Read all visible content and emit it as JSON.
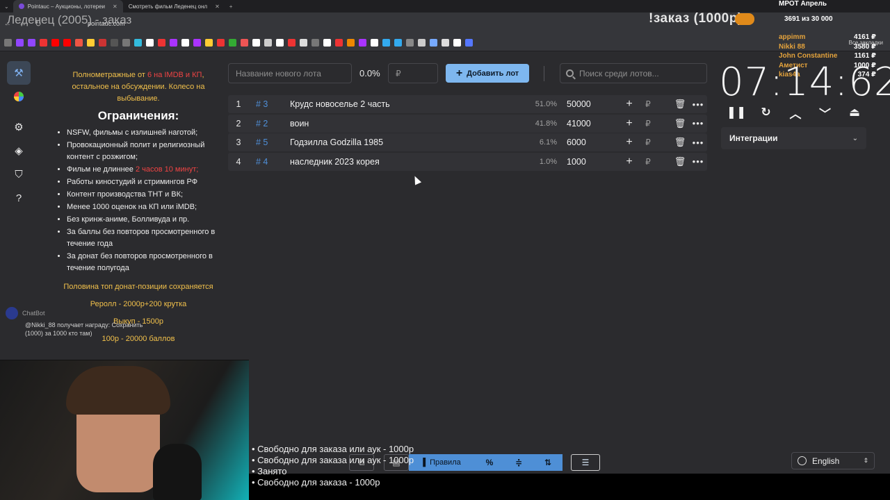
{
  "browser": {
    "tabs": [
      {
        "title": "Pointauc – Аукционы, лотереи",
        "active": true
      },
      {
        "title": "Смотреть фильм Леденец онл",
        "active": false
      }
    ],
    "url": "pointauc.com",
    "all_bookmarks": "Все закладки"
  },
  "stream_overlay": {
    "title": "Леденец (2005) - заказ",
    "order_label": "!заказ (1000р)",
    "mrot_label": "МРОТ Апрель",
    "progress": "3691  из 30 000",
    "donors": [
      {
        "name": "appimm",
        "amount": "4161 ₽"
      },
      {
        "name": "Nikki 88",
        "amount": "3580 ₽"
      },
      {
        "name": "John Constantine",
        "amount": "1161 ₽"
      },
      {
        "name": "Аметист",
        "amount": "1000 ₽"
      },
      {
        "name": "kias4a",
        "amount": "374 ₽"
      }
    ],
    "chatbot_name": "ChatBot",
    "chatbot_message": "@Nikki_88 получает награду: Сохранить (1000) за 1000 кто там)"
  },
  "rules": {
    "intro_part1": "Полнометражные от ",
    "intro_red": "6 на IMDB и КП",
    "intro_part2": ", остальное на обсуждении. Колесо на выбывание.",
    "heading": "Ограничения:",
    "items": [
      {
        "text": "NSFW, фильмы с излишней наготой;"
      },
      {
        "text": "Провокационный полит и религиозный контент с розжигом;"
      },
      {
        "text": "Фильм не длиннее ",
        "red": "2 часов 10 минут;"
      },
      {
        "text": "Работы киностудий и стримингов РФ"
      },
      {
        "text": "Контент производства ТНТ и ВК;"
      },
      {
        "text": "Менее 1000 оценок на КП или iMDB;"
      },
      {
        "text": "Без кринж-аниме, Болливуда и пр."
      },
      {
        "text": "За баллы без повторов просмотренного в течение года"
      },
      {
        "text": "За донат без повторов просмотренного в течение полугода"
      }
    ],
    "footer": [
      "Половина топ донат-позиции сохраняется",
      "Реролл - 2000р+200 крутка",
      "Выкуп - 1500р",
      "100р - 20000 баллов"
    ]
  },
  "controls": {
    "lot_name_placeholder": "Название нового лота",
    "percent": "0.0%",
    "amount_placeholder": "₽",
    "add_button": "Добавить лот",
    "search_placeholder": "Поиск среди лотов..."
  },
  "lots": [
    {
      "n": "1",
      "id": "# 3",
      "name": "Крудс новоселье 2 часть",
      "pct": "51.0%",
      "amount": "50000"
    },
    {
      "n": "2",
      "id": "# 2",
      "name": "воин",
      "pct": "41.8%",
      "amount": "41000"
    },
    {
      "n": "3",
      "id": "# 5",
      "name": "Годзилла Godzilla 1985",
      "pct": "6.1%",
      "amount": "6000"
    },
    {
      "n": "4",
      "id": "# 4",
      "name": "наследник 2023 корея",
      "pct": "1.0%",
      "amount": "1000"
    }
  ],
  "timer": {
    "display": "07:14:62",
    "integrations_label": "Интеграции"
  },
  "bottom": {
    "statuses": [
      "• Свободно для заказа или аук - 1000р",
      "• Свободно для заказа или аук - 1000р",
      "• Занято",
      "• Свободно для заказа - 1000р"
    ],
    "rules_button": "Правила",
    "language": "English"
  },
  "colors": {
    "accent_blue": "#7eb7ef",
    "lot_id_blue": "#4f8fd8",
    "rules_yellow": "#f1c04b",
    "rules_red": "#f04444",
    "donor_orange": "#e3a23c"
  }
}
